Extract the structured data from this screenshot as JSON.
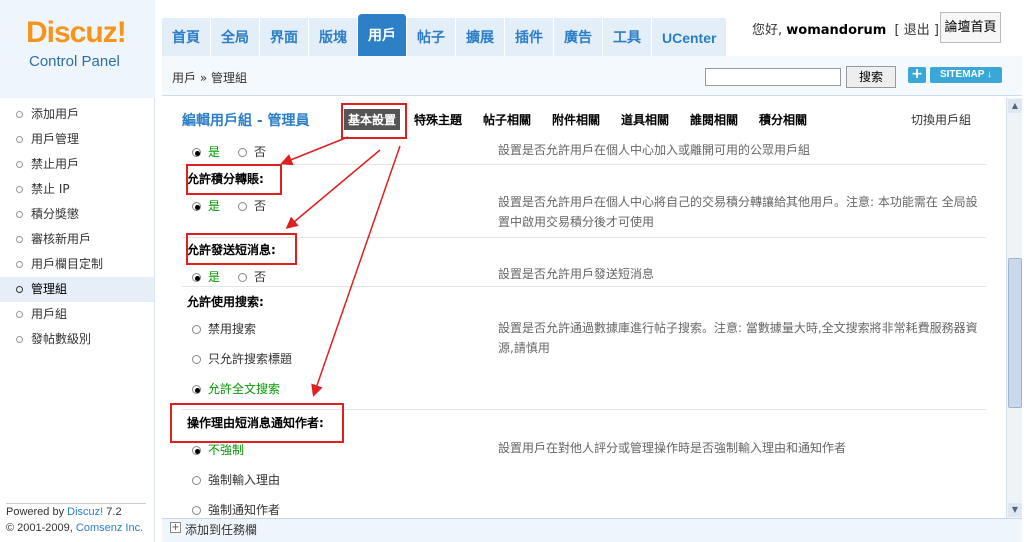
{
  "logo": {
    "brand": "Discuz!",
    "subtitle": "Control Panel"
  },
  "nav": {
    "tabs": [
      "首頁",
      "全局",
      "界面",
      "版塊",
      "用戶",
      "帖子",
      "擴展",
      "插件",
      "廣告",
      "工具",
      "UCenter"
    ],
    "active_index": 4
  },
  "user": {
    "greeting": "您好,",
    "name": "womandorum",
    "logout": "[ 退出 ]",
    "forum_home": "論壇首頁"
  },
  "crumb": "用戶 » 管理組",
  "search": {
    "value": "",
    "button": "搜索"
  },
  "toolbar": {
    "add": "+",
    "sitemap": "SITEMAP ↓"
  },
  "sidebar": {
    "items": [
      "添加用戶",
      "用戶管理",
      "禁止用戶",
      "禁止 IP",
      "積分獎懲",
      "審核新用戶",
      "用戶欄目定制",
      "管理組",
      "用戶組",
      "發帖數級別"
    ],
    "active_index": 7
  },
  "footer": {
    "powered_by": "Powered by",
    "product": "Discuz!",
    "version": "7.2",
    "copyright": "© 2001-2009,",
    "company": "Comsenz Inc."
  },
  "main": {
    "title": "編輯用戶組 - 管理員",
    "subtabs": [
      "基本設置",
      "特殊主題",
      "帖子相關",
      "附件相關",
      "道具相關",
      "誰閱相關",
      "積分相關"
    ],
    "active_subtab": 0,
    "switch_group": "切換用戶組",
    "yes": "是",
    "no": "否",
    "rows": [
      {
        "label": "",
        "desc": "設置是否允許用戶在個人中心加入或離開可用的公眾用戶組"
      },
      {
        "label": "允許積分轉賬:",
        "desc": "設置是否允許用戶在個人中心將自己的交易積分轉讓給其他用戶。注意: 本功能需在 全局設置中啟用交易積分後才可使用"
      },
      {
        "label": "允許發送短消息:",
        "desc": "設置是否允許用戶發送短消息"
      },
      {
        "label": "允許使用搜索:",
        "options": [
          "禁用搜索",
          "只允許搜索標題",
          "允許全文搜索"
        ],
        "desc": "設置是否允許通過數據庫進行帖子搜索。注意: 當數據量大時,全文搜索將非常耗費服務器資源,請慎用"
      },
      {
        "label": "操作理由短消息通知作者:",
        "options": [
          "不強制",
          "強制輸入理由",
          "強制通知作者"
        ],
        "desc": "設置用戶在對他人評分或管理操作時是否強制輸入理由和通知作者"
      }
    ]
  },
  "taskbar": {
    "plus": "+",
    "label": "添加到任務欄"
  },
  "colors": {
    "accent": "#2d7fc6",
    "highlight": "#e02020",
    "logo": "#f7941d",
    "selected_green": "#009900"
  }
}
